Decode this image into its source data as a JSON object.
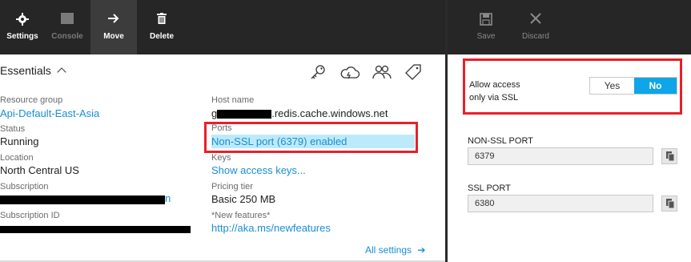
{
  "left_toolbar": {
    "buttons": [
      {
        "label": "Settings",
        "icon": "gear-icon"
      },
      {
        "label": "Console",
        "icon": "console-icon"
      },
      {
        "label": "Move",
        "icon": "arrow-right-icon"
      },
      {
        "label": "Delete",
        "icon": "trash-icon"
      }
    ]
  },
  "essentials": {
    "title": "Essentials",
    "header_icons": [
      "key-icon",
      "cloud-icon",
      "users-icon",
      "tag-icon"
    ],
    "resource_group_label": "Resource group",
    "resource_group_value": "Api-Default-East-Asia",
    "status_label": "Status",
    "status_value": "Running",
    "location_label": "Location",
    "location_value": "North Central US",
    "subscription_label": "Subscription",
    "subscription_value_suffix": "n",
    "subscription_id_label": "Subscription ID",
    "host_name_label": "Host name",
    "host_name_prefix": "g",
    "host_name_suffix": ".redis.cache.windows.net",
    "ports_label": "Ports",
    "ports_value": "Non-SSL port (6379) enabled",
    "keys_label": "Keys",
    "keys_value": "Show access keys...",
    "pricing_label": "Pricing tier",
    "pricing_value": "Basic 250 MB",
    "features_label": "*New features*",
    "features_value": "http://aka.ms/newfeatures",
    "all_settings": "All settings",
    "all_settings_arrow": "➔"
  },
  "right_toolbar": {
    "buttons": [
      {
        "label": "Save",
        "icon": "save-icon"
      },
      {
        "label": "Discard",
        "icon": "close-icon"
      }
    ]
  },
  "ssl_settings": {
    "allow_label_line1": "Allow access",
    "allow_label_line2": "only via SSL",
    "toggle_yes": "Yes",
    "toggle_no": "No",
    "toggle_selected": "No",
    "non_ssl_port_label": "NON-SSL PORT",
    "non_ssl_port_value": "6379",
    "ssl_port_label": "SSL PORT",
    "ssl_port_value": "6380"
  },
  "colors": {
    "toolbar_bg": "#262626",
    "link": "#1a8ed1",
    "highlight_red": "#e8202a",
    "toggle_selected": "#0ea5e9",
    "ports_highlight": "#bdeafa"
  }
}
